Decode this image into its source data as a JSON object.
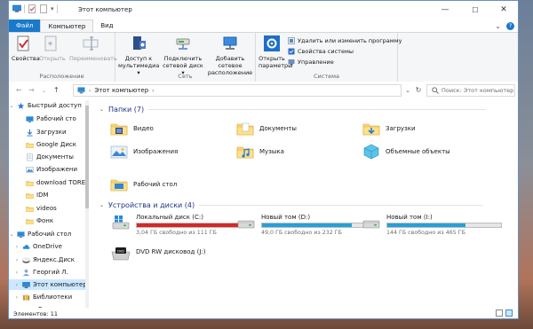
{
  "window": {
    "title": "Этот компьютер",
    "controls": {
      "minimize": "—",
      "maximize": "☐",
      "close": "✕"
    }
  },
  "ribbon": {
    "tabs": [
      "Файл",
      "Компьютер",
      "Вид"
    ],
    "groups": {
      "location": {
        "label": "Расположение",
        "buttons": [
          "Свойства",
          "Открыть",
          "Переименовать"
        ]
      },
      "network": {
        "label": "Сеть",
        "buttons": [
          {
            "line1": "Доступ к",
            "line2": "мультимедиа ▾"
          },
          {
            "line1": "Подключить",
            "line2": "сетевой диск ▾"
          },
          {
            "line1": "Добавить сетевое",
            "line2": "расположение"
          }
        ]
      },
      "system": {
        "label": "Система",
        "open_params": {
          "line1": "Открыть",
          "line2": "параметры"
        },
        "links": [
          "Удалить или изменить программу",
          "Свойства системы",
          "Управление"
        ]
      }
    }
  },
  "address": {
    "path": "Этот компьютер",
    "search_placeholder": "Поиск: Этот компьютер"
  },
  "nav": {
    "items": [
      {
        "label": "Быстрый доступ",
        "pinned": false,
        "icon": "star-icon"
      },
      {
        "label": "Рабочий сто",
        "pinned": true,
        "icon": "desktop-icon"
      },
      {
        "label": "Загрузки",
        "pinned": true,
        "icon": "download-icon"
      },
      {
        "label": "Google Диск",
        "pinned": true,
        "icon": "folder-icon"
      },
      {
        "label": "Документы",
        "pinned": true,
        "icon": "documents-icon"
      },
      {
        "label": "Изображени",
        "pinned": true,
        "icon": "pictures-icon"
      },
      {
        "label": "download TOREN",
        "pinned": false,
        "icon": "folder-icon"
      },
      {
        "label": "IDM",
        "pinned": false,
        "icon": "folder-icon"
      },
      {
        "label": "videos",
        "pinned": false,
        "icon": "folder-icon"
      },
      {
        "label": "Фонк",
        "pinned": false,
        "icon": "folder-icon"
      },
      {
        "label": "Рабочий стол",
        "pinned": false,
        "icon": "desktop-icon"
      },
      {
        "label": "OneDrive",
        "pinned": false,
        "icon": "cloud-icon"
      },
      {
        "label": "Яндекс.Диск",
        "pinned": false,
        "icon": "yandex-disk-icon"
      },
      {
        "label": "Георгий Л.",
        "pinned": false,
        "icon": "user-icon"
      },
      {
        "label": "Этот компьютер",
        "pinned": false,
        "icon": "computer-icon",
        "selected": true
      },
      {
        "label": "Библиотеки",
        "pinned": false,
        "icon": "library-icon"
      },
      {
        "label": "Видео",
        "pinned": false,
        "icon": "video-folder-icon"
      }
    ]
  },
  "folders": {
    "heading": "Папки (7)",
    "items": [
      {
        "label": "Видео",
        "icon": "video-folder-icon"
      },
      {
        "label": "Документы",
        "icon": "documents-folder-icon"
      },
      {
        "label": "Загрузки",
        "icon": "downloads-folder-icon"
      },
      {
        "label": "Изображения",
        "icon": "pictures-folder-icon"
      },
      {
        "label": "Музыка",
        "icon": "music-folder-icon"
      },
      {
        "label": "Объемные объекты",
        "icon": "3d-objects-folder-icon"
      },
      {
        "label": "Рабочий стол",
        "icon": "desktop-folder-icon"
      }
    ]
  },
  "devices": {
    "heading": "Устройства и диски (4)",
    "drives": [
      {
        "name": "Локальный диск (C:)",
        "free": "3,04 ГБ свободно из 111 ГБ",
        "used_fraction": 0.973,
        "color": "#da2626"
      },
      {
        "name": "Новый том (D:)",
        "free": "49,0 ГБ свободно из 232 ГБ",
        "used_fraction": 0.789,
        "color": "#26a0da"
      },
      {
        "name": "Новый том (I:)",
        "free": "144 ГБ свободно из 465 ГБ",
        "used_fraction": 0.69,
        "color": "#26a0da"
      }
    ],
    "dvd": {
      "name": "DVD RW дисковод (J:)"
    }
  },
  "status": {
    "items_count": "Элементов: 11"
  }
}
